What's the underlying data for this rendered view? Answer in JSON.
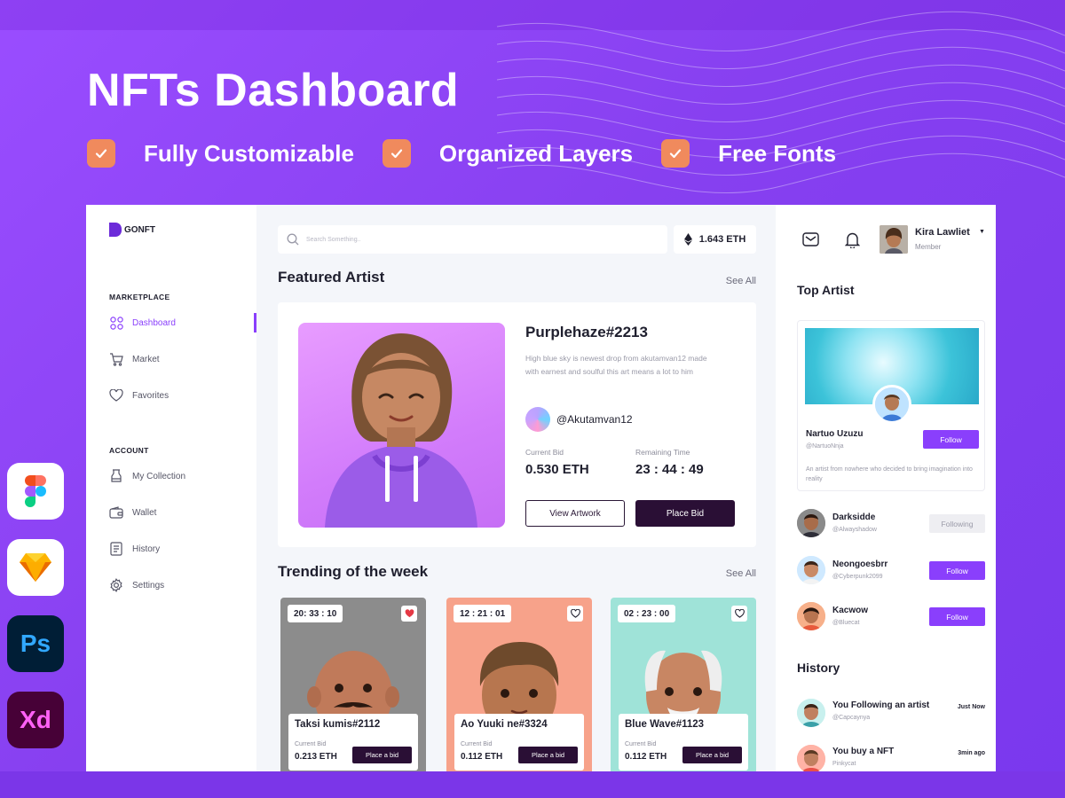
{
  "hero": {
    "title": "NFTs Dashboard",
    "features": [
      "Fully Customizable",
      "Organized Layers",
      "Free Fonts"
    ]
  },
  "tools": [
    {
      "name": "figma",
      "label": ""
    },
    {
      "name": "sketch",
      "label": ""
    },
    {
      "name": "photoshop",
      "label": "Ps"
    },
    {
      "name": "xd",
      "label": "Xd"
    }
  ],
  "colors": {
    "accent": "#8a3ffc",
    "dark_button": "#2a0f35",
    "check_orange": "#f08a5d",
    "background": "#8a44f2"
  },
  "sidebar": {
    "logo": "GONFT",
    "marketplace_label": "MARKETPLACE",
    "account_label": "ACCOUNT",
    "marketplace_items": [
      {
        "label": "Dashboard",
        "icon": "grid-icon",
        "active": true
      },
      {
        "label": "Market",
        "icon": "cart-icon",
        "active": false
      },
      {
        "label": "Favorites",
        "icon": "heart-icon",
        "active": false
      }
    ],
    "account_items": [
      {
        "label": "My Collection",
        "icon": "collection-icon"
      },
      {
        "label": "Wallet",
        "icon": "wallet-icon"
      },
      {
        "label": "History",
        "icon": "history-icon"
      },
      {
        "label": "Settings",
        "icon": "gear-icon"
      }
    ]
  },
  "header": {
    "search_placeholder": "Search Something..",
    "eth_balance": "1.643 ETH"
  },
  "featured": {
    "section_title": "Featured Artist",
    "see_all": "See All",
    "name": "Purplehaze#2213",
    "description": "High blue sky is newest drop from akutamvan12 made with earnest and soulful this art means a lot to him",
    "handle": "@Akutamvan12",
    "current_bid_label": "Current Bid",
    "current_bid": "0.530 ETH",
    "remaining_label": "Remaining Time",
    "remaining_time": "23 : 44 : 49",
    "view_button": "View Artwork",
    "bid_button": "Place Bid"
  },
  "trending": {
    "section_title": "Trending of the week",
    "see_all": "See All",
    "cards": [
      {
        "timer": "20: 33 : 10",
        "liked": true,
        "name": "Taksi kumis#2112",
        "bid_label": "Current Bid",
        "price": "0.213 ETH",
        "button": "Place a bid",
        "bg": "#8c8c8c"
      },
      {
        "timer": "12 : 21 : 01",
        "liked": false,
        "name": "Ao Yuuki ne#3324",
        "bid_label": "Current Bid",
        "price": "0.112 ETH",
        "button": "Place a bid",
        "bg": "#f7a28a"
      },
      {
        "timer": "02 : 23 : 00",
        "liked": false,
        "name": "Blue Wave#1123",
        "bid_label": "Current Bid",
        "price": "0.112 ETH",
        "button": "Place a bid",
        "bg": "#9fe3d8"
      }
    ]
  },
  "user": {
    "name": "Kira Lawliet",
    "role": "Member"
  },
  "top_artist": {
    "section_title": "Top Artist",
    "name": "Nartuo Uzuzu",
    "handle": "@NartuoNnja",
    "follow": "Follow",
    "description": "An artist from nowhere who decided to bring imagination into reality"
  },
  "artists": [
    {
      "name": "Darksidde",
      "handle": "@Alwayshadow",
      "button": "Following",
      "following": true
    },
    {
      "name": "Neongoesbrr",
      "handle": "@Cyberpunk2099",
      "button": "Follow",
      "following": false
    },
    {
      "name": "Kacwow",
      "handle": "@Bluecat",
      "button": "Follow",
      "following": false
    }
  ],
  "history": {
    "section_title": "History",
    "items": [
      {
        "title": "You Following an artist",
        "sub": "@Capcaynya",
        "time": "Just Now"
      },
      {
        "title": "You buy a  NFT",
        "sub": "Pinkycat",
        "time": "3min ago"
      }
    ]
  }
}
